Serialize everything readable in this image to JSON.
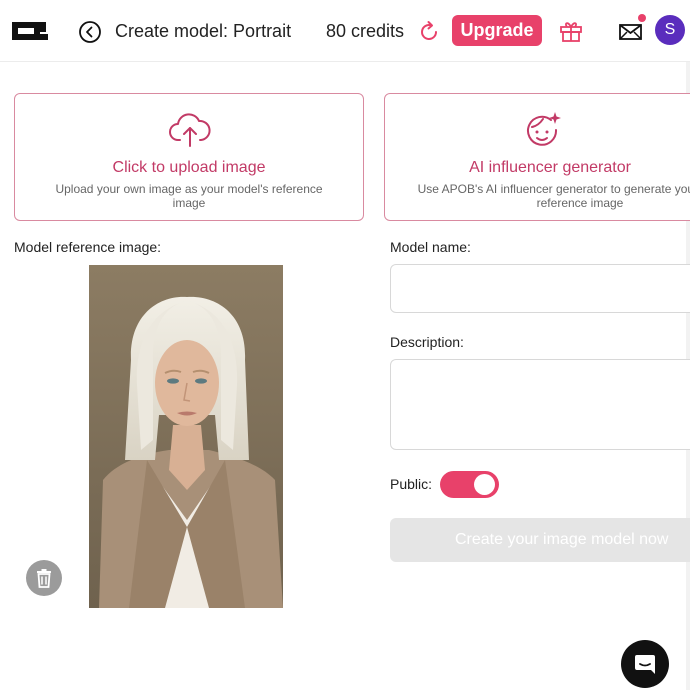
{
  "header": {
    "title": "Create model: Portrait",
    "credits": "80 credits",
    "upgrade_label": "Upgrade",
    "avatar_initial": "S"
  },
  "cards": {
    "upload": {
      "title": "Click to upload image",
      "description": "Upload your own image as your model's reference image"
    },
    "ai": {
      "title": "AI influencer generator",
      "description": "Use APOB's AI influencer generator to generate your model's reference image"
    }
  },
  "form": {
    "reference_label": "Model reference image:",
    "name_label": "Model name:",
    "name_value": "",
    "description_label": "Description:",
    "description_value": "",
    "public_label": "Public:",
    "public_enabled": true,
    "create_button": "Create your image model now"
  },
  "colors": {
    "accent": "#e8416a",
    "card_border": "#d98aa0",
    "avatar": "#5a2dbd"
  }
}
